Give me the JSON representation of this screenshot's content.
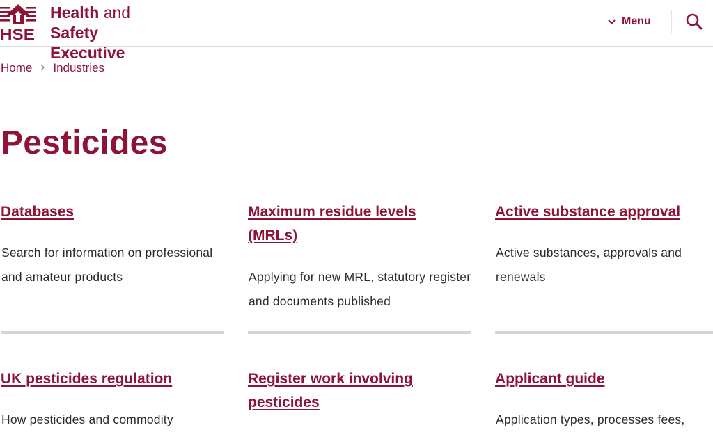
{
  "brand": {
    "colors": {
      "accent": "#8f1337",
      "divider": "#d4d4d4"
    },
    "logo_abbrev": "HSE",
    "logo_line1_bold": "Health",
    "logo_line1_light": "and",
    "logo_line1_end": "Safety",
    "logo_line2": "Executive"
  },
  "header": {
    "menu_label": "Menu",
    "menu_icon": "chevron-down-icon",
    "search_icon": "search-icon"
  },
  "breadcrumb": {
    "items": [
      "Home",
      "Industries"
    ],
    "separator_icon": "chevron-right-icon"
  },
  "page": {
    "title": "Pesticides"
  },
  "cards": [
    {
      "title": "Databases",
      "description": "Search for information on professional and amateur products"
    },
    {
      "title": "Maximum residue levels (MRLs)",
      "description": "Applying for new MRL, statutory register and documents published"
    },
    {
      "title": "Active substance approval",
      "description": "Active substances, approvals and renewals"
    },
    {
      "title": "UK pesticides regulation",
      "description": "How pesticides and commodity"
    },
    {
      "title": "Register work involving pesticides",
      "description": ""
    },
    {
      "title": "Applicant guide",
      "description": "Application types, processes fees,"
    }
  ]
}
